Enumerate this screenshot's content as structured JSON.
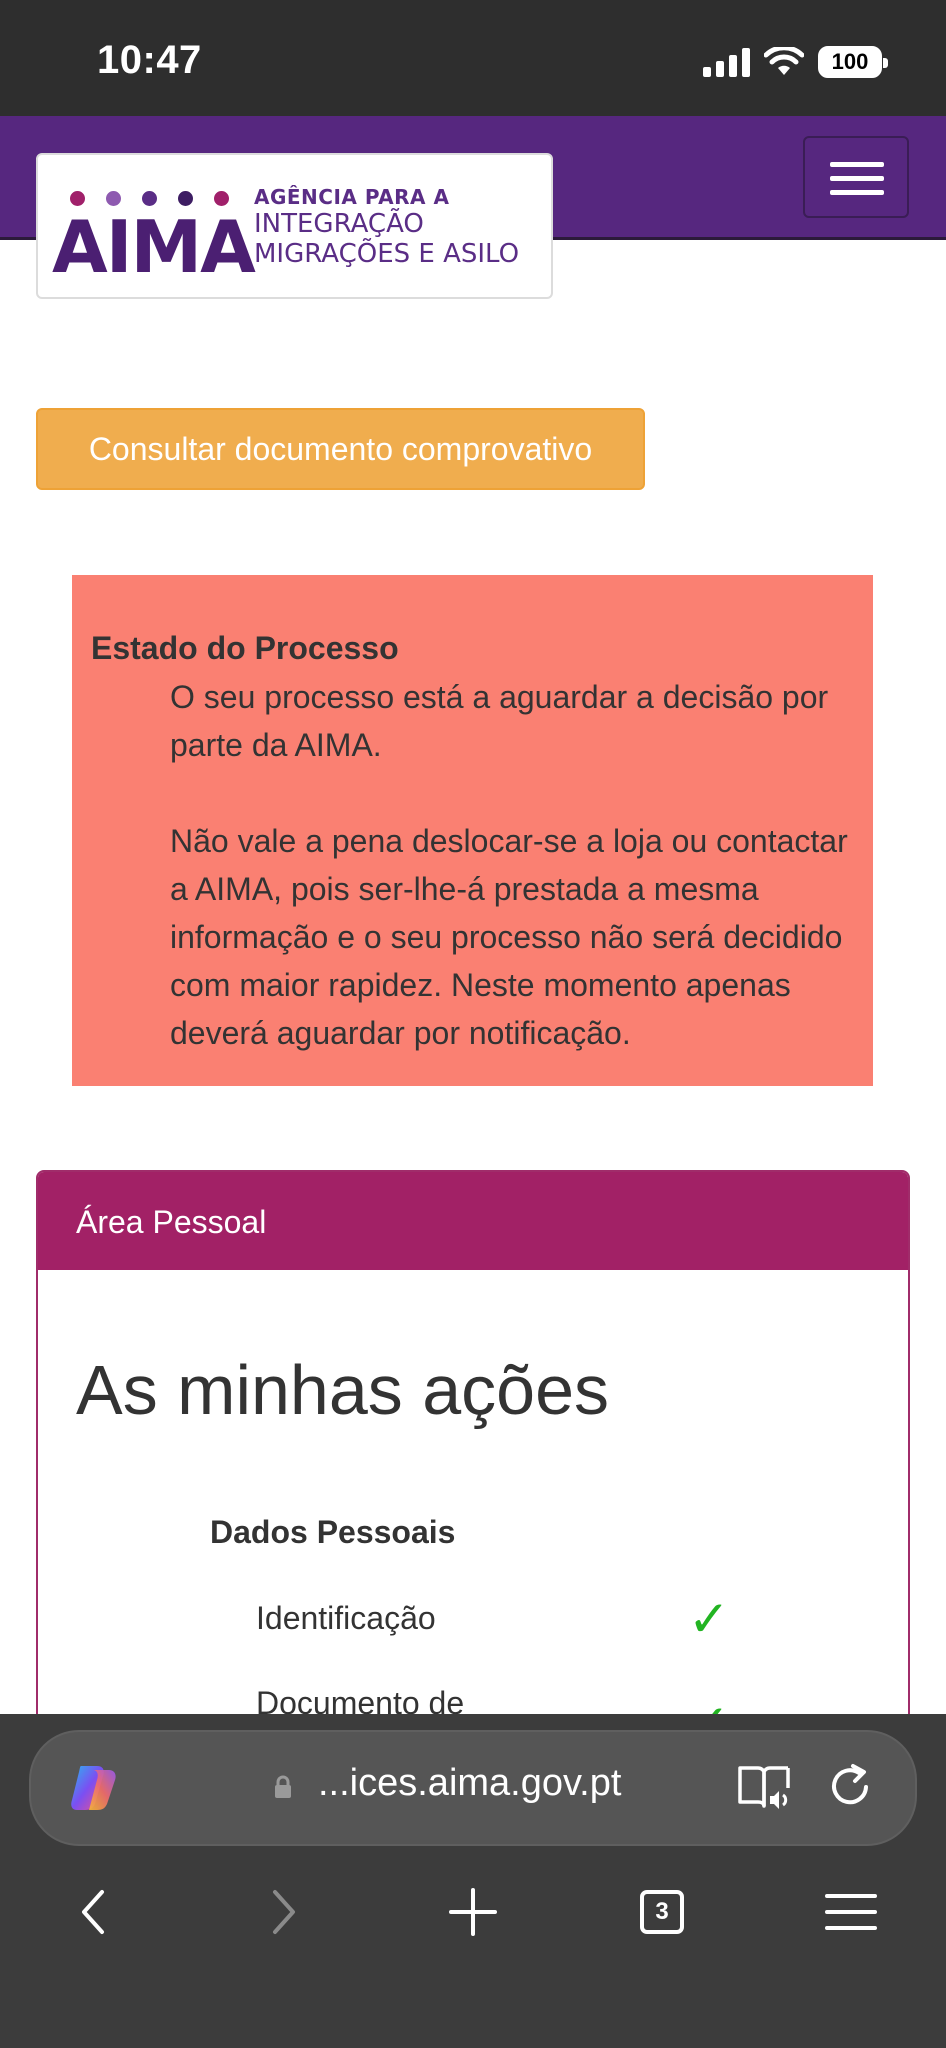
{
  "status_bar": {
    "time": "10:47",
    "battery": "100"
  },
  "logo": {
    "word": "AIMA",
    "line1": "AGÊNCIA PARA A",
    "line2": "INTEGRAÇÃO",
    "line3": "MIGRAÇÕES E ASILO",
    "dot_colors": [
      "#a0206a",
      "#8e5ab0",
      "#5a2d86",
      "#3d1d63",
      "#a0206a"
    ]
  },
  "consult_button": {
    "label": "Consultar documento comprovativo"
  },
  "alert": {
    "title": "Estado do Processo",
    "paragraph1": "O seu processo está a aguardar a decisão por parte da AIMA.",
    "paragraph2": "Não vale a pena deslocar-se a loja ou contactar a AIMA, pois ser-lhe-á prestada a mesma informação e o seu processo não será decidido com maior rapidez. Neste momento apenas deverá aguardar por notificação."
  },
  "panel": {
    "heading": "Área Pessoal",
    "title": "As minhas ações",
    "section": "Dados Pessoais",
    "items": [
      {
        "label": "Identificação",
        "status": "✓"
      },
      {
        "label": "Documento de",
        "status": "✓"
      }
    ]
  },
  "browser": {
    "url": "...ices.aima.gov.pt",
    "tab_count": "3"
  },
  "colors": {
    "header": "#56277f",
    "panel_heading": "#a22166",
    "alert_bg": "#fa8072",
    "button": "#f0ad4e",
    "check": "#22b422"
  }
}
